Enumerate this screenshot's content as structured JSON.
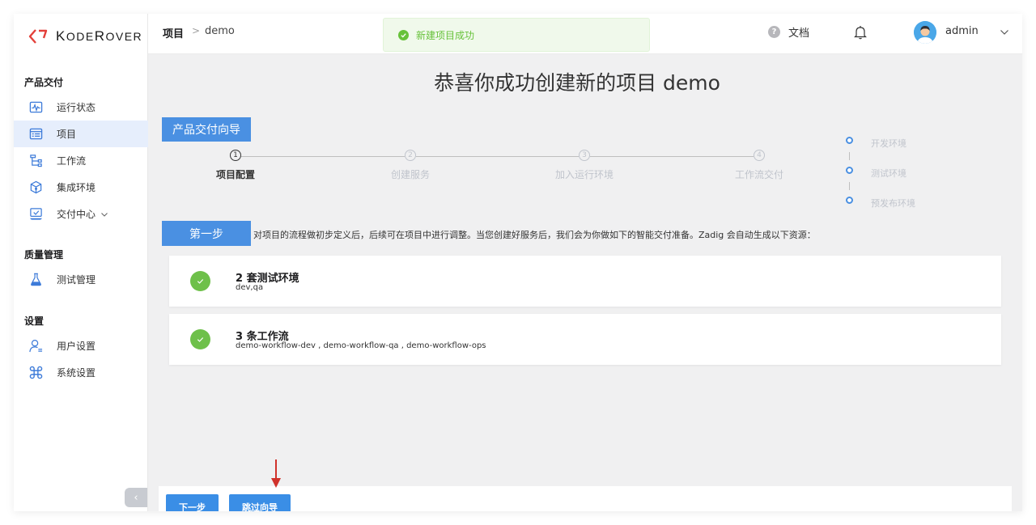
{
  "app": {
    "brand": "KodeRover"
  },
  "sidebar": {
    "sections": [
      {
        "title": "产品交付"
      },
      {
        "title": "质量管理"
      },
      {
        "title": "设置"
      }
    ],
    "items": [
      {
        "label": "运行状态",
        "icon": "pulse-chart-icon"
      },
      {
        "label": "项目",
        "icon": "list-doc-icon",
        "active": true
      },
      {
        "label": "工作流",
        "icon": "workflow-tree-icon"
      },
      {
        "label": "集成环境",
        "icon": "cube-icon"
      },
      {
        "label": "交付中心",
        "icon": "delivery-box-icon",
        "has_chevron": true
      },
      {
        "label": "测试管理",
        "icon": "flask-icon"
      },
      {
        "label": "用户设置",
        "icon": "user-list-icon"
      },
      {
        "label": "系统设置",
        "icon": "command-icon"
      }
    ],
    "collapse_glyph": "‹"
  },
  "header": {
    "breadcrumb_root": "项目",
    "breadcrumb_sep": ">",
    "breadcrumb_leaf": "demo",
    "toast": "新建项目成功",
    "docs_label": "文档",
    "docs_icon_glyph": "?",
    "user_name": "admin"
  },
  "main": {
    "title": "恭喜你成功创建新的项目 demo",
    "guide_badge": "产品交付向导",
    "steps": [
      {
        "num": "1",
        "label": "项目配置",
        "current": true
      },
      {
        "num": "2",
        "label": "创建服务"
      },
      {
        "num": "3",
        "label": "加入运行环境"
      },
      {
        "num": "4",
        "label": "工作流交付"
      }
    ],
    "envs": [
      "开发环境",
      "测试环境",
      "预发布环境"
    ],
    "step_badge": "第一步",
    "step_desc": "对项目的流程做初步定义后，后续可在项目中进行调整。当您创建好服务后，我们会为你做如下的智能交付准备。Zadig 会自动生成以下资源：",
    "cards": [
      {
        "title": "2 套测试环境",
        "sub": "dev,qa"
      },
      {
        "title": "3 条工作流",
        "sub": "demo-workflow-dev , demo-workflow-qa , demo-workflow-ops"
      }
    ],
    "next_button": "下一步",
    "skip_button": "跳过向导"
  },
  "colors": {
    "accent": "#3a8ee6",
    "success": "#67c23a",
    "annotation_arrow": "#d0322b"
  }
}
